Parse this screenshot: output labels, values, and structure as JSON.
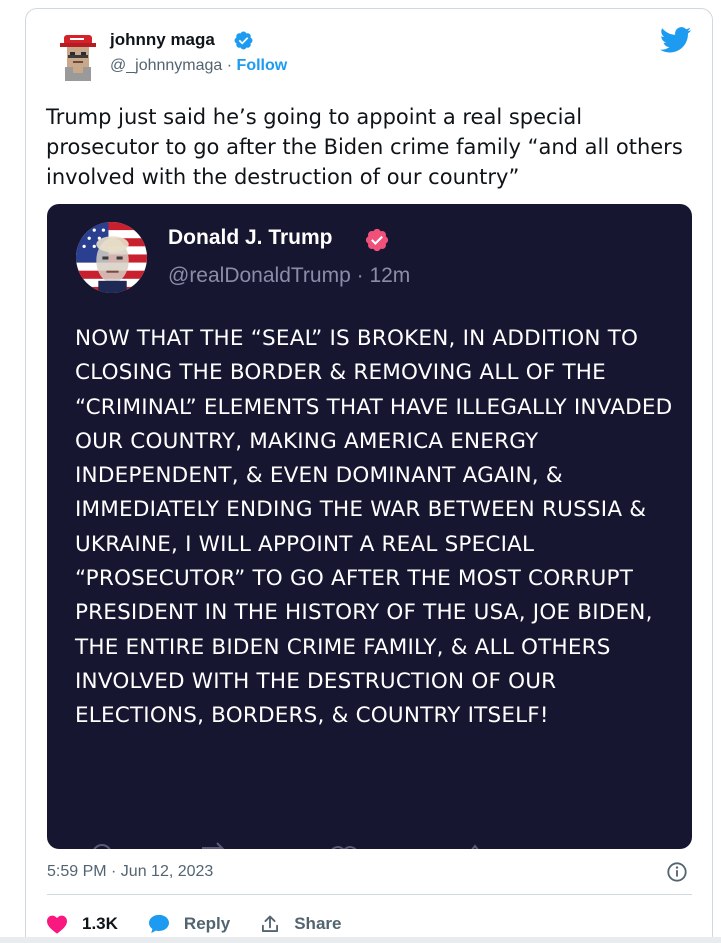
{
  "author": {
    "name": "johnny maga",
    "handle": "@_johnnymaga",
    "separator": "·",
    "follow_label": "Follow"
  },
  "tweet": {
    "text": "Trump just said he’s going to appoint a real special prosecutor to go after the Biden crime family “and all others involved with the destruction of our country”",
    "timestamp": "5:59 PM · Jun 12, 2023"
  },
  "embedded_post": {
    "name": "Donald J. Trump",
    "handle": "@realDonaldTrump · 12m",
    "text": "NOW THAT THE “SEAL” IS BROKEN, IN ADDITION TO CLOSING THE BORDER & REMOVING ALL OF THE “CRIMINAL” ELEMENTS THAT HAVE ILLEGALLY INVADED OUR COUNTRY, MAKING AMERICA ENERGY INDEPENDENT, & EVEN DOMINANT AGAIN, & IMMEDIATELY ENDING THE WAR BETWEEN RUSSIA & UKRAINE, I WILL APPOINT A REAL SPECIAL “PROSECUTOR” TO GO AFTER THE MOST CORRUPT PRESIDENT IN THE HISTORY OF THE USA, JOE BIDEN, THE ENTIRE BIDEN CRIME FAMILY, & ALL OTHERS INVOLVED WITH THE DESTRUCTION OF OUR ELECTIONS, BORDERS, & COUNTRY ITSELF!"
  },
  "actions": {
    "like_count": "1.3K",
    "reply_label": "Reply",
    "share_label": "Share"
  },
  "colors": {
    "accent_blue": "#1d9bf0",
    "like_pink": "#f91880",
    "embed_bg": "#161631",
    "truth_badge": "#f0507a"
  },
  "icons": {
    "twitter_logo": "twitter-bird-icon",
    "verified": "verified-badge-icon",
    "info": "info-icon",
    "like": "heart-icon",
    "reply": "speech-bubble-icon",
    "share": "share-upload-icon"
  }
}
